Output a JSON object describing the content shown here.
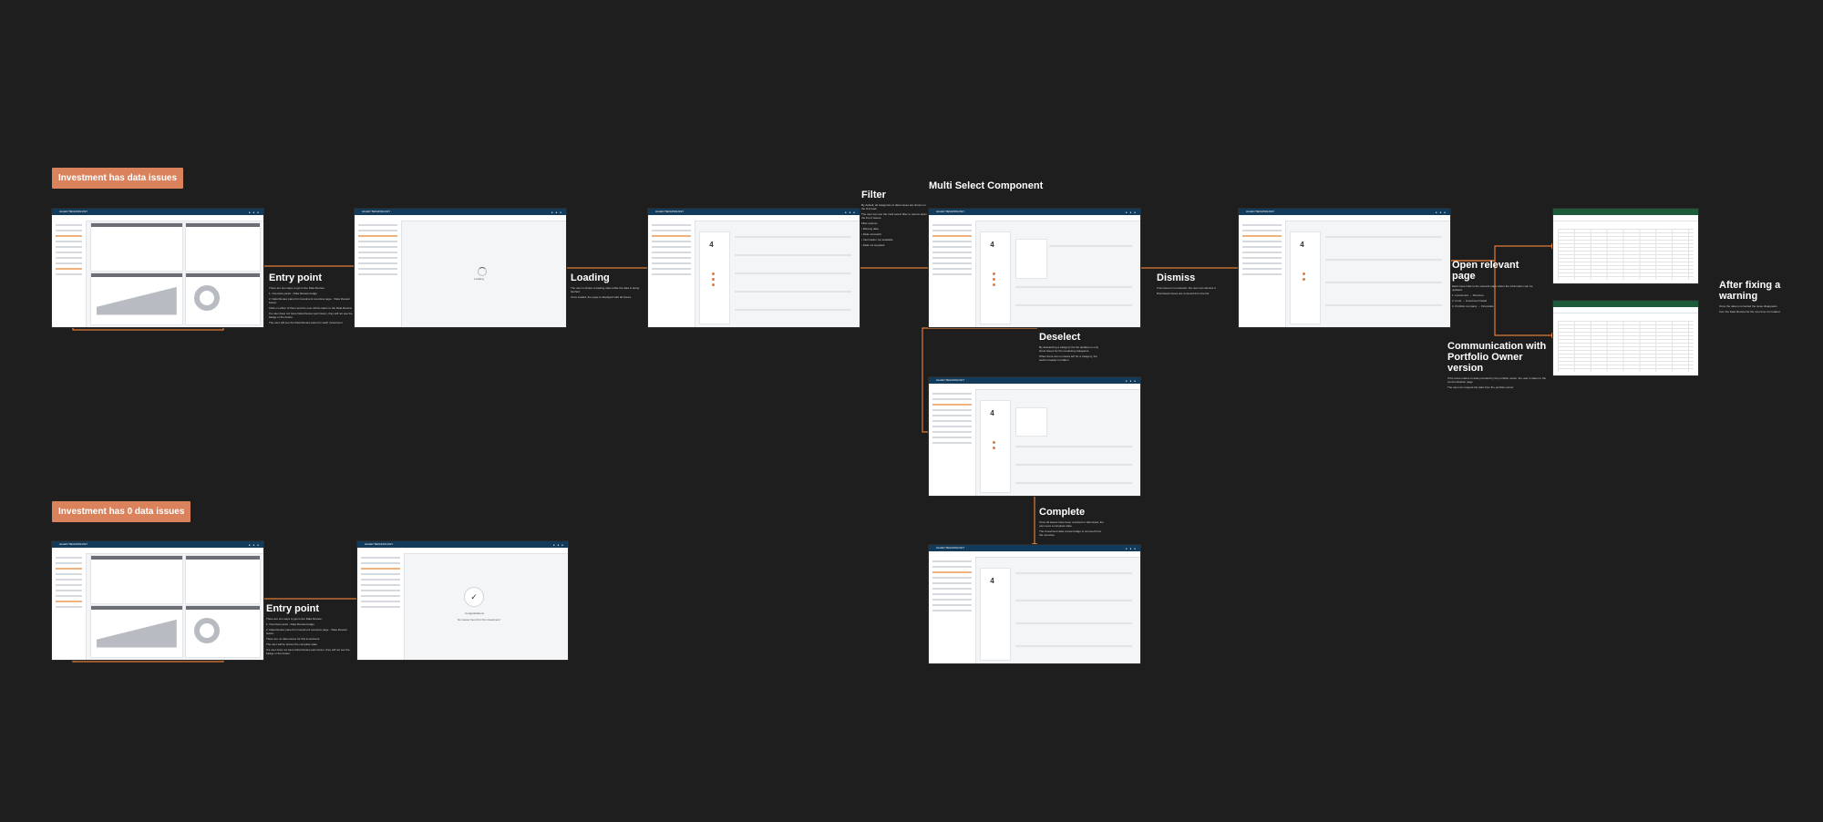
{
  "scenarios": {
    "issues": "Investment has data issues",
    "no_issues": "Investment has 0 data issues"
  },
  "app": {
    "brand": "ALLEN TECHNOLOGY"
  },
  "headings": {
    "multi_select": "Multi Select Component"
  },
  "steps": {
    "entry_point_1": {
      "title": "Entry point",
      "body": [
        "There are two ways to get to the Data Review:",
        "1. Overview panel - Data Review badge",
        "2. Data Review panel for investment overview page - 'Data Review' button",
        "Click on either of them and the user will be taken to the Data Review",
        "If a user does not have Data Review permission, they will not see the badge or the button.",
        "The user will see the Data Review panel for each investment"
      ]
    },
    "loading": {
      "title": "Loading",
      "body": [
        "The user is shown a loading state while the data is being fetched",
        "Once loaded, the page is displayed with all issues"
      ]
    },
    "filter": {
      "title": "Filter",
      "body": [
        "By default, all categories of data issues are shown on the first load.",
        "The user can use the multi select filter to narrow down the list of issues.",
        "Filter options:",
        "• Missing data",
        "• Data mismatch",
        "• Information not available",
        "• Data not supplied"
      ]
    },
    "dismiss": {
      "title": "Dismiss",
      "body": [
        "If an issue is not relevant, the user can dismiss it",
        "Dismissed issues are removed from the list"
      ]
    },
    "deselect": {
      "title": "Deselect",
      "body": [
        "By deselecting a category the list updates to only show issues for the remaining categories.",
        "When there are no issues left for a category, the section header is hidden."
      ]
    },
    "complete": {
      "title": "Complete",
      "body": [
        "Once all issues have been resolved or dismissed, the user sees a complete state",
        "The investment data review badge is removed from the overview"
      ]
    },
    "open_page": {
      "title": "Open relevant page",
      "body": [
        "Each issue links to the relevant page where the information can be updated",
        "1. Investment → Structure",
        "2. Fund → Investment Detail",
        "3. Portfolio company → Financials"
      ]
    },
    "communication": {
      "title": "Communication with Portfolio Owner version",
      "body": [
        "If the issue relates to data provided by the portfolio owner, the user is taken to the communication page",
        "The user can request the data from the portfolio owner"
      ]
    },
    "after_fix": {
      "title": "After fixing a warning",
      "body": [
        "Once the data is corrected the issue disappears",
        "from the Data Review list the next time it is loaded"
      ]
    },
    "entry_point_2": {
      "title": "Entry point",
      "body": [
        "There are two ways to get to the Data Review:",
        "1. Overview panel - Data Review badge",
        "2. Data Review panel for investment overview page - 'Data Review' button",
        "There are no data issues for this investment",
        "The user will be shown the complete state",
        "If a user does not have Data Review permission, they will not see the badge or the button."
      ]
    }
  },
  "screens": {
    "loading_text": "Loading",
    "count_value": "4",
    "complete_title": "Congratulations",
    "complete_sub": "No issues found for this investment"
  }
}
